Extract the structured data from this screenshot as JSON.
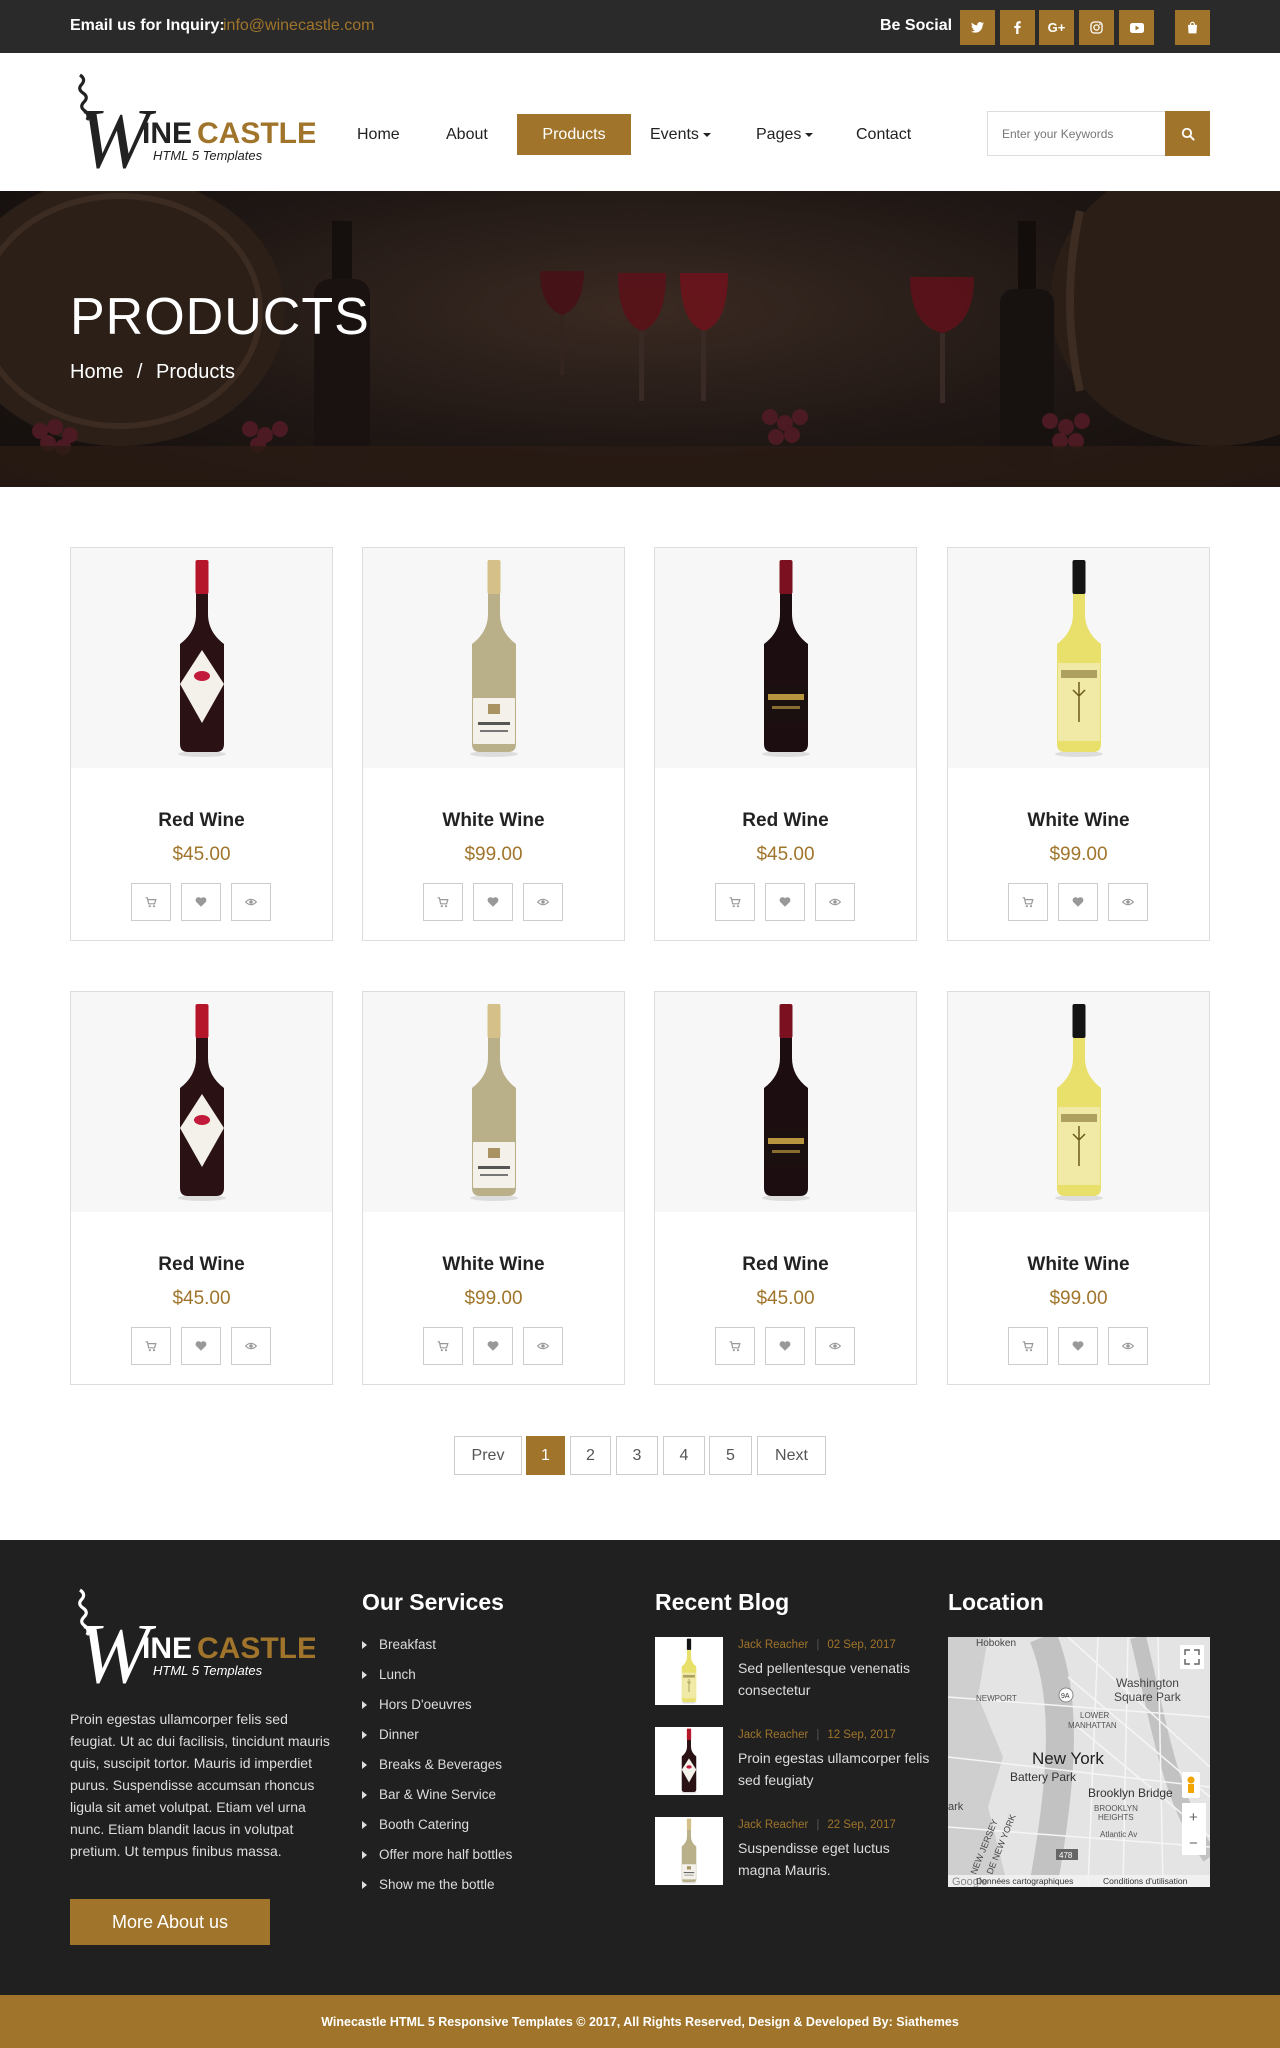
{
  "topbar": {
    "inquiry_label": "Email us for Inquiry:",
    "email": "info@winecastle.com",
    "social_label": "Be Social",
    "social_icons": [
      "twitter-icon",
      "facebook-icon",
      "google-plus-icon",
      "instagram-icon",
      "youtube-icon",
      "shopping-bag-icon"
    ],
    "google_plus_text": "G+"
  },
  "brand": {
    "name_w": "W",
    "name_ine": "INE",
    "name_castle": "CASTLE",
    "tagline": "HTML 5 Templates",
    "accent_color": "#a0752b",
    "dark_color": "#202020"
  },
  "nav": {
    "home": "Home",
    "about": "About",
    "products": "Products",
    "events": "Events",
    "pages": "Pages",
    "contact": "Contact",
    "active": "Products"
  },
  "search": {
    "placeholder": "Enter your Keywords"
  },
  "banner": {
    "title": "PRODUCTS",
    "crumb_home": "Home",
    "crumb_sep": "/",
    "crumb_current": "Products"
  },
  "products": [
    {
      "name": "Red Wine",
      "price": "$45.00",
      "bottle": "red-lips"
    },
    {
      "name": "White Wine",
      "price": "$99.00",
      "bottle": "white-gold"
    },
    {
      "name": "Red Wine",
      "price": "$45.00",
      "bottle": "red-dark"
    },
    {
      "name": "White Wine",
      "price": "$99.00",
      "bottle": "white-yellow"
    },
    {
      "name": "Red Wine",
      "price": "$45.00",
      "bottle": "red-lips"
    },
    {
      "name": "White Wine",
      "price": "$99.00",
      "bottle": "white-gold"
    },
    {
      "name": "Red Wine",
      "price": "$45.00",
      "bottle": "red-dark"
    },
    {
      "name": "White Wine",
      "price": "$99.00",
      "bottle": "white-yellow"
    }
  ],
  "product_actions": [
    "cart-icon",
    "heart-icon",
    "eye-icon"
  ],
  "pagination": {
    "prev": "Prev",
    "pages": [
      "1",
      "2",
      "3",
      "4",
      "5"
    ],
    "next": "Next",
    "current": "1"
  },
  "footer": {
    "about": "Proin egestas ullamcorper felis sed feugiat. Ut ac dui facilisis, tincidunt mauris quis, suscipit tortor. Mauris id imperdiet purus. Suspendisse accumsan rhoncus ligula sit amet volutpat. Etiam vel urna nunc. Etiam blandit lacus in volutpat pretium. Ut tempus finibus massa.",
    "more_button": "More About us",
    "services_title": "Our Services",
    "services": [
      "Breakfast",
      "Lunch",
      "Hors D'oeuvres",
      "Dinner",
      "Breaks & Beverages",
      "Bar & Wine Service",
      "Booth Catering",
      "Offer more half bottles",
      "Show me the bottle"
    ],
    "blog_title": "Recent Blog",
    "blog": [
      {
        "author": "Jack Reacher",
        "date": "02 Sep, 2017",
        "text": "Sed pellentesque venenatis consectetur"
      },
      {
        "author": "Jack Reacher",
        "date": "12 Sep, 2017",
        "text": "Proin egestas ullamcorper felis sed feugiaty"
      },
      {
        "author": "Jack Reacher",
        "date": "22 Sep, 2017",
        "text": "Suspendisse eget luctus magna Mauris."
      }
    ],
    "location_title": "Location",
    "map": {
      "hoboken": "Hoboken",
      "washington": "Washington",
      "square_park": "Square Park",
      "newport": "NEWPORT",
      "lower": "LOWER",
      "manhattan": "MANHATTAN",
      "new_york": "New York",
      "battery_park": "Battery Park",
      "brooklyn_bridge": "Brooklyn Bridge",
      "brooklyn": "BROOKLYN",
      "heights": "HEIGHTS",
      "atlantic": "Atlantic Av",
      "ark": "ark",
      "new_jersey": "NEW JERSEY",
      "de_new_york": "DE NEW YORK",
      "route_9a": "9A",
      "route_478": "478",
      "google": "Google",
      "map_data": "Données cartographiques",
      "terms": "Conditions d'utilisation",
      "zoom_in": "+",
      "zoom_out": "−"
    },
    "copyright": "Winecastle HTML 5 Responsive Templates © 2017, All Rights Reserved, Design & Developed By: Siathemes"
  }
}
